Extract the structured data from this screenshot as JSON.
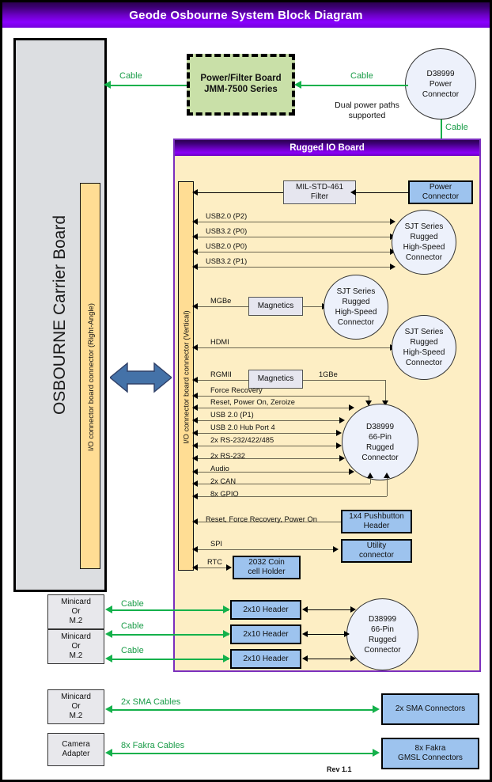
{
  "title": "Geode Osbourne System Block Diagram",
  "revision": "Rev 1.1",
  "colors": {
    "title_purple": "#8a00ff",
    "io_board_bg": "#fdeec4",
    "io_board_border": "#7b2fbe",
    "connector_tan": "#ffdd94",
    "blue_block": "#9dc3ee",
    "green_cable": "#14b14b",
    "power_filter_green": "#c9e0a8",
    "carrier_grey": "#dcdee1",
    "big_arrow_blue": "#4472a8"
  },
  "carrier": {
    "label": "OSBOURNE Carrier Board",
    "right_angle_connector": "I/O connector board connector (Right-Angle)",
    "modules": [
      {
        "name": "Minicard Or M.2",
        "lines": [
          "Minicard",
          "Or",
          "M.2"
        ]
      },
      {
        "name": "Minicard Or M.2",
        "lines": [
          "Minicard",
          "Or",
          "M.2"
        ]
      },
      {
        "name": "Minicard Or M.2",
        "lines": [
          "Minicard",
          "Or",
          "M.2"
        ]
      },
      {
        "name": "Camera Adapter",
        "lines": [
          "Camera",
          "Adapter"
        ]
      }
    ]
  },
  "power_path": {
    "power_filter_board": {
      "line1": "Power/Filter Board",
      "line2": "JMM-7500 Series"
    },
    "d38999_power_connector": [
      "D38999",
      "Power",
      "Connector"
    ],
    "cable_left": "Cable",
    "cable_right": "Cable",
    "cable_down": "Cable",
    "note": "Dual power paths supported",
    "note_line1": "Dual power paths",
    "note_line2": "supported"
  },
  "io_board": {
    "header": "Rugged IO Board",
    "vertical_connector": "I/O connector board connector (Vertical)",
    "filter_block": {
      "line1": "MIL-STD-461",
      "line2": "Filter"
    },
    "power_connector_block": {
      "line1": "Power",
      "line2": "Connector"
    },
    "usb_signals": [
      "USB2.0 (P2)",
      "USB3.2 (P0)",
      "USB2.0 (P0)",
      "USB3.2 (P1)"
    ],
    "sjt_connector_1": [
      "SJT Series",
      "Rugged",
      "High-Speed",
      "Connector"
    ],
    "sjt_connector_2": [
      "SJT Series",
      "Rugged",
      "High-Speed",
      "Connector"
    ],
    "sjt_connector_3": [
      "SJT Series",
      "Rugged",
      "High-Speed",
      "Connector"
    ],
    "mgbe_label": "MGBe",
    "magnetics_1": "Magnetics",
    "hdmi_label": "HDMI",
    "rgmii_label": "RGMII",
    "magnetics_2": "Magnetics",
    "gbe_label": "1GBe",
    "d38999_66pin": [
      "D38999",
      "66-Pin",
      "Rugged",
      "Connector"
    ],
    "bus_signals": [
      "Force Recovery",
      "Reset, Power On, Zeroize",
      "USB 2.0 (P1)",
      "USB 2.0 Hub Port 4",
      "2x  RS-232/422/485",
      "2x RS-232",
      "Audio",
      "2x CAN",
      "8x GPIO"
    ],
    "pushbutton_signal": "Reset, Force Recovery, Power On",
    "pushbutton_header": {
      "line1": "1x4 Pushbutton",
      "line2": "Header"
    },
    "spi_label": "SPI",
    "utility_connector": {
      "line1": "Utility",
      "line2": "connector"
    },
    "rtc_label": "RTC",
    "coin_cell": {
      "line1": "2032 Coin",
      "line2": "cell Holder"
    },
    "headers_2x10": [
      {
        "label": "2x10 Header",
        "cable": "Cable"
      },
      {
        "label": "2x10 Header",
        "cable": "Cable"
      },
      {
        "label": "2x10 Header",
        "cable": "Cable"
      }
    ],
    "d38999_66pin_lower": [
      "D38999",
      "66-Pin",
      "Rugged",
      "Connector"
    ]
  },
  "bottom_links": [
    {
      "cable": "2x SMA Cables",
      "target": "2x SMA Connectors",
      "target_lines": [
        "2x SMA Connectors"
      ]
    },
    {
      "cable": "8x Fakra Cables",
      "target": "8x Fakra GMSL Connectors",
      "target_lines": [
        "8x Fakra",
        "GMSL Connectors"
      ]
    }
  ]
}
